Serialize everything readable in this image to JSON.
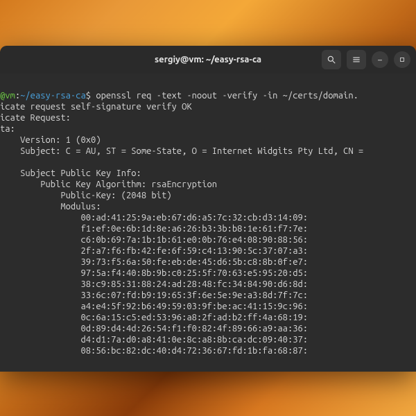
{
  "titlebar": {
    "title": "sergiy@vm: ~/easy-rsa-ca"
  },
  "prompt": {
    "user_host": "@vm",
    "sep": ":",
    "path": "~/easy-rsa-ca",
    "dollar": "$"
  },
  "command": " openssl req -text -noout -verify -in ~/certs/domain.",
  "output": {
    "l1": "icate request self-signature verify OK",
    "l2": "icate Request:",
    "l3": "ta:",
    "l4": "    Version: 1 (0x0)",
    "l5": "    Subject: C = AU, ST = Some-State, O = Internet Widgits Pty Ltd, CN = ",
    "l6": "",
    "l7": "    Subject Public Key Info:",
    "l8": "        Public Key Algorithm: rsaEncryption",
    "l9": "            Public-Key: (2048 bit)",
    "l10": "            Modulus:",
    "m1": "                00:ad:41:25:9a:eb:67:d6:a5:7c:32:cb:d3:14:09:",
    "m2": "                f1:ef:0e:6b:1d:8e:a6:26:b3:3b:b8:1e:61:f7:7e:",
    "m3": "                c6:0b:69:7a:1b:1b:61:e0:0b:76:e4:08:90:88:56:",
    "m4": "                2f:a7:f6:fb:42:fe:6f:59:c4:13:90:5c:37:07:a3:",
    "m5": "                39:73:f5:6a:50:fe:eb:de:45:d6:5b:c8:8b:0f:e7:",
    "m6": "                97:5a:f4:40:8b:9b:c0:25:5f:70:63:e5:95:20:d5:",
    "m7": "                38:c9:85:31:88:24:ad:28:48:fc:34:84:90:d6:8d:",
    "m8": "                33:6c:07:fd:b9:19:65:3f:6e:5e:9e:a3:8d:7f:7c:",
    "m9": "                a4:e4:5f:92:b6:49:59:03:9f:be:ac:41:15:9c:96:",
    "m10": "                0c:6a:15:c5:ed:53:96:a8:2f:ad:b2:ff:4a:68:19:",
    "m11": "                0d:89:d4:4d:26:54:f1:f0:82:4f:89:66:a9:aa:36:",
    "m12": "                d4:d1:7a:d0:a8:41:0e:8c:a8:8b:ca:dc:09:40:37:",
    "m13": "                08:56:bc:82:dc:40:d4:72:36:67:fd:1b:fa:68:87:"
  }
}
